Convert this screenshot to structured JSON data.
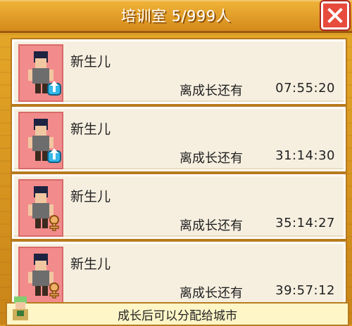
{
  "header": {
    "title": "培训室 5/999人"
  },
  "cards": [
    {
      "name": "新生儿",
      "growth_label": "离成长还有",
      "timer": "07:55:20",
      "gender_icon": "male-icon"
    },
    {
      "name": "新生儿",
      "growth_label": "离成长还有",
      "timer": "31:14:30",
      "gender_icon": "male-icon"
    },
    {
      "name": "新生儿",
      "growth_label": "离成长还有",
      "timer": "35:14:27",
      "gender_icon": "female-icon"
    },
    {
      "name": "新生儿",
      "growth_label": "离成长还有",
      "timer": "39:57:12",
      "gender_icon": "female-icon"
    }
  ],
  "footer": {
    "hint": "成长后可以分配给城市"
  },
  "colors": {
    "accent_title": "#d48a1a",
    "close_button": "#e74b3c",
    "avatar_bg": "#f28b8b",
    "male_badge": "#35b7e8",
    "female_badge": "#f0b06a"
  }
}
